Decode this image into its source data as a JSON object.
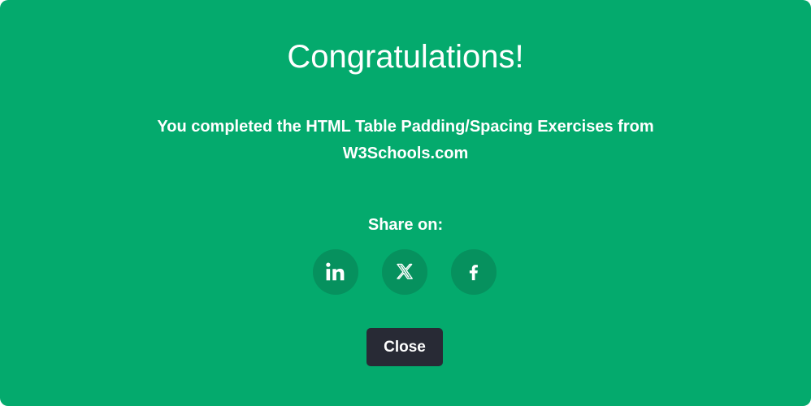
{
  "modal": {
    "title": "Congratulations!",
    "message_line1": "You completed the HTML Table Padding/Spacing Exercises from",
    "message_line2": "W3Schools.com",
    "share_label": "Share on:",
    "social_buttons": [
      {
        "icon": "linkedin-icon"
      },
      {
        "icon": "x-icon"
      },
      {
        "icon": "facebook-icon"
      }
    ],
    "close_label": "Close"
  },
  "colors": {
    "background": "#04aa6d",
    "social_circle": "#06915e",
    "close_button": "#282a35",
    "text": "#ffffff"
  }
}
